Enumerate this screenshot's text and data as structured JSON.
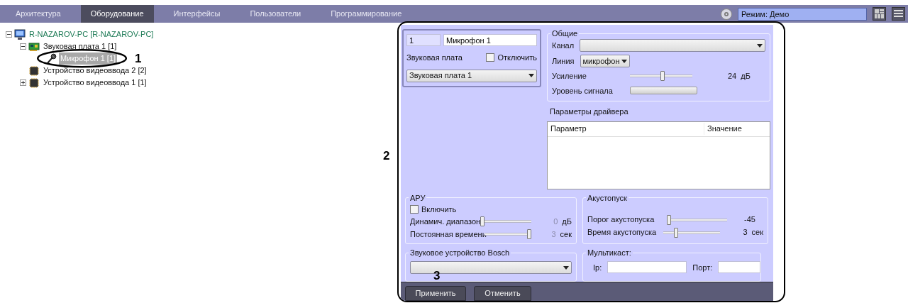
{
  "nav": {
    "tabs": [
      {
        "label": "Архитектура",
        "selected": false
      },
      {
        "label": "Оборудование",
        "selected": true
      },
      {
        "label": "Интерфейсы",
        "selected": false
      },
      {
        "label": "Пользователи",
        "selected": false
      },
      {
        "label": "Программирование",
        "selected": false
      }
    ],
    "mode_field": {
      "value": "Режим: Демо"
    }
  },
  "tree": [
    {
      "label": "R-NAZAROV-PC [R-NAZAROV-PC]",
      "kind": "computer",
      "expanded": true,
      "selected": false,
      "children": [
        {
          "label": "Звуковая плата 1 [1]",
          "kind": "soundcard",
          "expanded": true,
          "selected": false,
          "children": [
            {
              "label": "Микрофон 1 [1]",
              "kind": "microphone",
              "selected": true
            }
          ]
        },
        {
          "label": "Устройство видеоввода 2 [2]",
          "kind": "chip",
          "selected": false
        },
        {
          "label": "Устройство видеоввода 1 [1]",
          "kind": "chip",
          "expanded": false,
          "selected": false
        }
      ]
    }
  ],
  "annotations": [
    {
      "label": "1"
    },
    {
      "label": "2"
    },
    {
      "label": "3"
    }
  ],
  "device": {
    "id": "1",
    "name": "Микрофон 1",
    "card_label": "Звуковая плата",
    "disable": {
      "label": "Отключить",
      "checked": false
    },
    "card_value": "Звуковая плата 1"
  },
  "general": {
    "title": "Общие",
    "channel_label": "Канал",
    "line_label": "Линия",
    "line_value": "микрофон",
    "gain": {
      "label": "Усиление",
      "level": 0.53,
      "reading": "24",
      "unit": "дБ"
    },
    "signal": {
      "label": "Уровень сигнала",
      "level": 0
    }
  },
  "driver_params": {
    "title": "Параметры драйвера",
    "columns": [
      "Параметр",
      "Значение"
    ]
  },
  "agc": {
    "title": "АРУ",
    "enable": {
      "label": "Включить",
      "checked": false
    },
    "sliders": [
      {
        "label": "Динамич. диапазон",
        "level": 0,
        "reading": "0",
        "unit": "дБ",
        "disabled": true
      },
      {
        "label": "Постоянная времени",
        "level": 1,
        "reading": "3",
        "unit": "сек",
        "disabled": true
      }
    ]
  },
  "acoustic": {
    "title": "Акустопуск",
    "sliders": [
      {
        "label": "Порог акустопуска",
        "level": 0,
        "reading": "-45",
        "disabled": false
      },
      {
        "label": "Время акустопуска",
        "level": 0.2,
        "reading": "3",
        "unit": "сек",
        "disabled": false
      }
    ]
  },
  "bosch": {
    "title": "Звуковое устройство Bosch"
  },
  "multicast": {
    "title": "Мультикаст:",
    "ip_label": "Ip:",
    "port_label": "Порт:"
  },
  "buttons": [
    {
      "label": "Применить"
    },
    {
      "label": "Отменить"
    }
  ]
}
